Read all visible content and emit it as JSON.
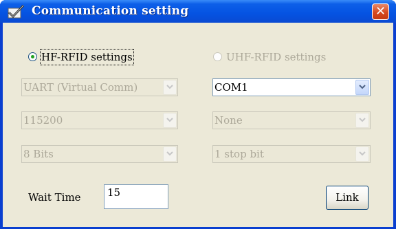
{
  "window": {
    "title": "Communication setting",
    "title_icon": "checkmark-settings-icon",
    "close_icon": "close-icon",
    "close_glyph": "✕"
  },
  "radios": {
    "hf": {
      "label": "HF-RFID settings",
      "selected": true
    },
    "uhf": {
      "label": "UHF-RFID settings",
      "selected": false,
      "enabled": false
    }
  },
  "left_column": {
    "interface": {
      "value": "UART (Virtual Comm)",
      "enabled": false
    },
    "baud_rate": {
      "value": "115200",
      "enabled": false
    },
    "data_bits": {
      "value": "8 Bits",
      "enabled": false
    }
  },
  "right_column": {
    "port": {
      "value": "COM1",
      "enabled": true
    },
    "parity": {
      "value": "None",
      "enabled": false
    },
    "stop_bits": {
      "value": "1 stop bit",
      "enabled": false
    }
  },
  "wait_time": {
    "label": "Wait Time",
    "value": "15"
  },
  "link_button": {
    "label": "Link"
  },
  "colors": {
    "title_bar": "#0553e2",
    "dialog_bg": "#ece9d8",
    "close_red": "#d6491f",
    "radio_dot": "#21a121"
  }
}
